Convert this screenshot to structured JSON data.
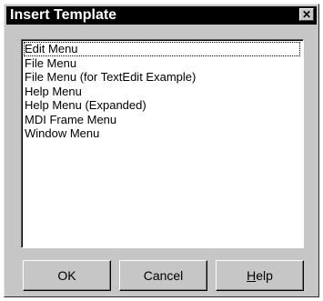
{
  "dialog": {
    "title": "Insert Template",
    "close_glyph": "✕",
    "close_icon": "close-icon"
  },
  "list": {
    "items": [
      "Edit Menu",
      "File Menu",
      "File Menu (for TextEdit Example)",
      "Help Menu",
      "Help Menu (Expanded)",
      "MDI Frame Menu",
      "Window Menu"
    ],
    "selected_index": 0
  },
  "buttons": {
    "ok": "OK",
    "cancel": "Cancel",
    "help_mnemonic": "H",
    "help_rest": "elp"
  },
  "colors": {
    "title_bar": "#000000",
    "dialog_face": "#c6c6c6",
    "list_background": "#ffffff"
  }
}
